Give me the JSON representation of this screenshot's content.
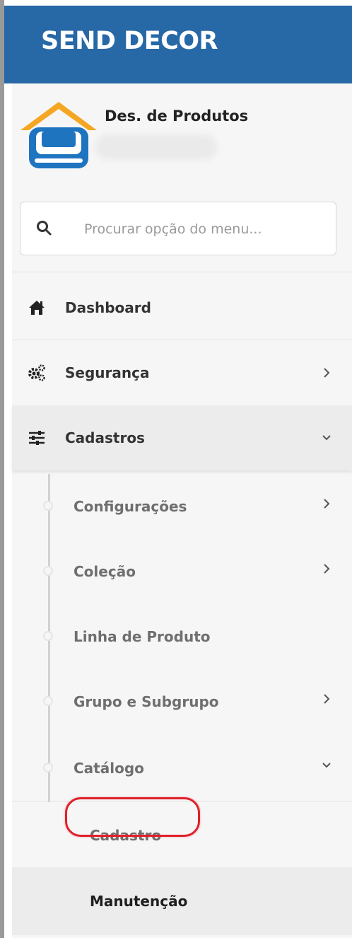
{
  "app": {
    "brand": "SEND DECOR"
  },
  "user": {
    "name": "Des. de Produtos"
  },
  "search": {
    "placeholder": "Procurar opção do menu..."
  },
  "icons": {
    "search": "search-icon",
    "dashboard": "home-icon",
    "seguranca": "gears-icon",
    "cadastros": "sliders-icon",
    "chevron_right": "chevron-right-icon",
    "chevron_down": "chevron-down-icon"
  },
  "colors": {
    "header": "#2768a6",
    "highlight": "#e0202a",
    "avatar_blue": "#1f74c0",
    "avatar_roof": "#f5a623"
  },
  "menu": {
    "dashboard": "Dashboard",
    "seguranca": "Segurança",
    "cadastros": "Cadastros",
    "cadastros_children": {
      "configuracoes": "Configurações",
      "colecao": "Coleção",
      "linha_produto": "Linha de Produto",
      "grupo_subgrupo": "Grupo e Subgrupo",
      "catalogo": "Catálogo"
    },
    "catalogo_children": {
      "cadastro": "Cadastro",
      "manutencao": "Manutenção"
    }
  }
}
